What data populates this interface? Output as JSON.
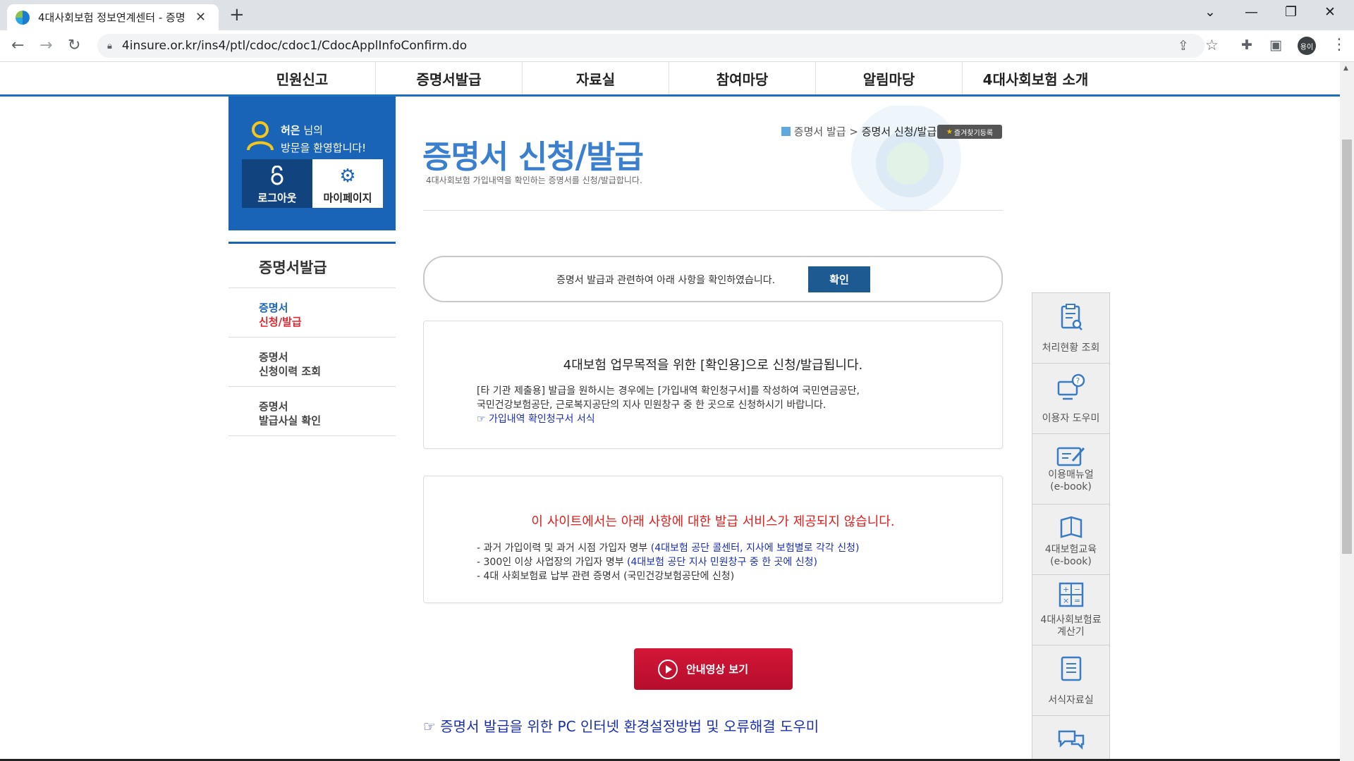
{
  "browser": {
    "tab_title": "4대사회보험 정보연계센터 - 증명",
    "tab_close": "✕",
    "new_tab": "+",
    "url": "4insure.or.kr/ins4/ptl/cdoc/cdoc1/CdocApplInfoConfirm.do",
    "profile_label": "용이",
    "icons": [
      "back-arrow-icon",
      "forward-arrow-icon",
      "reload-icon",
      "lock-icon",
      "share-icon",
      "star-icon",
      "extensions-icon",
      "side-panel-icon",
      "kebab-menu-icon"
    ]
  },
  "gnb": {
    "items": [
      "민원신고",
      "증명서발급",
      "자료실",
      "참여마당",
      "알림마당",
      "4대사회보험 소개"
    ]
  },
  "login": {
    "user_name": "허은",
    "suffix": " 님의",
    "welcome": "방문을 환영합니다!",
    "logout_label": "로그아웃",
    "mypage_label": "마이페이지"
  },
  "sidebar": {
    "title": "증명서발급",
    "items": [
      {
        "line1": "증명서",
        "line2": "신청/발급",
        "active": true
      },
      {
        "line1": "증명서",
        "line2": "신청이력 조회",
        "active": false
      },
      {
        "line1": "증명서",
        "line2": "발급사실 확인",
        "active": false
      }
    ]
  },
  "header": {
    "title": "증명서 신청/발급",
    "subtitle": "4대사회보험 가입내역을 확인하는 증명서를 신청/발급합니다.",
    "breadcrumb_parent": "증명서 발급",
    "breadcrumb_sep": ">",
    "breadcrumb_current": "증명서 신청/발급",
    "bookmark_label": "즐겨찾기등록"
  },
  "confirm": {
    "text": "증명서 발급과 관련하여 아래 사항을 확인하였습니다.",
    "button": "확인"
  },
  "box1": {
    "title": "4대보험 업무목적을 위한 [확인용]으로 신청/발급됩니다.",
    "line1": "[타 기관 제출용] 발급을 원하시는 경우에는 [가입내역 확인청구서]를 작성하여 국민연금공단,",
    "line2": "국민건강보험공단, 근로복지공단의 지사 민원창구 중 한 곳으로 신청하시기 바랍니다.",
    "link": "☞ 가입내역 확인청구서 서식"
  },
  "box2": {
    "title": "이 사이트에서는 아래 사항에 대한 발급 서비스가 제공되지 않습니다.",
    "items": [
      {
        "text": "- 과거 가입이력 및 과거 시점 가입자 명부 ",
        "link": "(4대보험 공단 콜센터, 지사에 보험별로 각각 신청)"
      },
      {
        "text": "- 300인 이상 사업장의 가입자 명부 ",
        "link": "(4대보험 공단 지사 민원창구 중 한 곳에 신청)"
      },
      {
        "text": "- 4대 사회보험료 납부 관련 증명서 (국민건강보험공단에 신청)",
        "link": ""
      }
    ]
  },
  "video_button": "안내영상 보기",
  "help_link": "☞ 증명서 발급을 위한 PC 인터넷 환경설정방법 및 오류해결 도우미",
  "quick_menu": [
    {
      "label": "처리현황 조회",
      "icon": "clipboard-search-icon"
    },
    {
      "label": "이용자 도우미",
      "icon": "help-monitor-icon"
    },
    {
      "label": "이용매뉴얼\n(e-book)",
      "icon": "manual-edit-icon"
    },
    {
      "label": "4대보험교육\n(e-book)",
      "icon": "book-icon"
    },
    {
      "label": "4대사회보험료\n계산기",
      "icon": "calculator-icon"
    },
    {
      "label": "서식자료실",
      "icon": "document-icon"
    },
    {
      "label": "",
      "icon": "chat-bubble-icon"
    }
  ],
  "colors": {
    "primary_blue": "#1a64b8",
    "title_blue": "#3b7fcf",
    "alert_red": "#e21b1b",
    "link_blue": "#1a2fb0",
    "video_button": "#c8102e"
  }
}
